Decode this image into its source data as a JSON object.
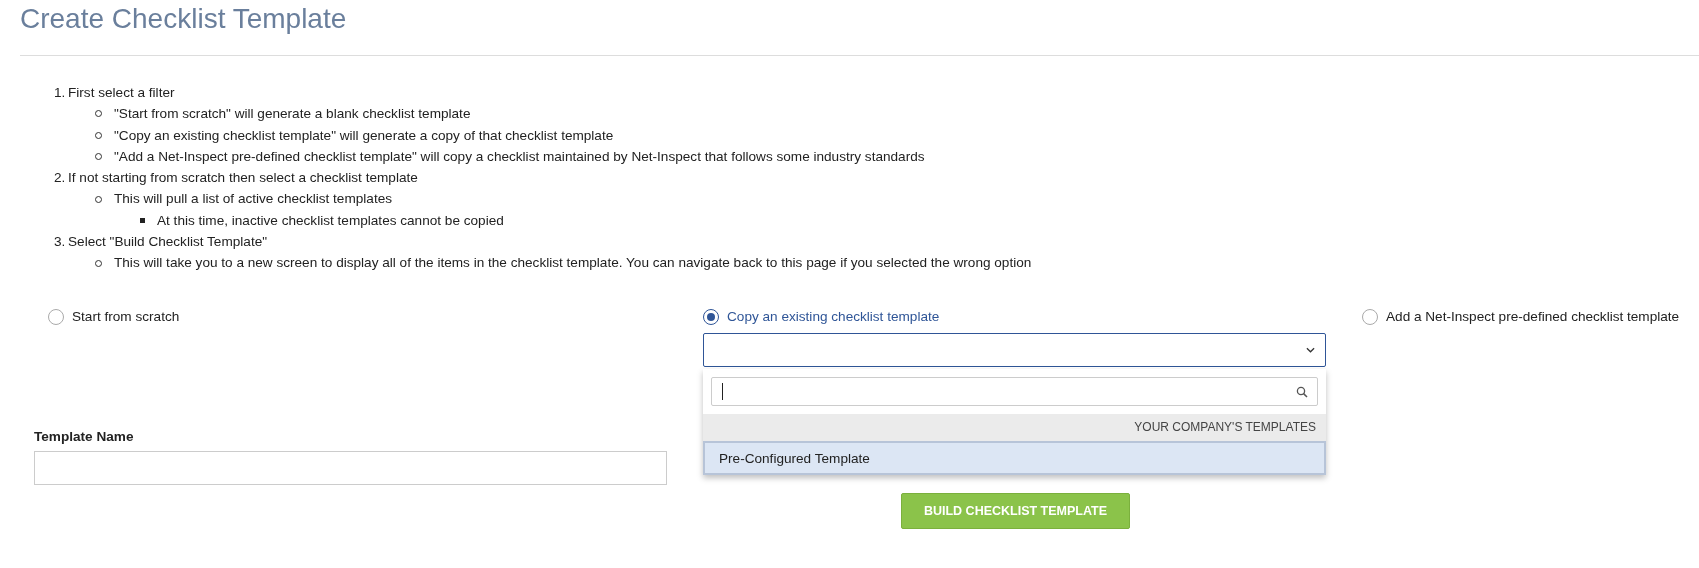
{
  "title": "Create Checklist Template",
  "instructions": [
    {
      "number": "1.",
      "text": "First select a filter",
      "children": [
        {
          "text": "\"Start from scratch\" will generate a blank checklist template"
        },
        {
          "text": "\"Copy an existing checklist template\" will generate a copy of that checklist template"
        },
        {
          "text": "\"Add a Net-Inspect pre-defined checklist template\" will copy a checklist maintained by Net-Inspect that follows some industry standards"
        }
      ]
    },
    {
      "number": "2.",
      "text": "If not starting from scratch then select a checklist template",
      "children": [
        {
          "text": "This will pull a list of active checklist templates",
          "children": [
            {
              "text": "At this time, inactive checklist templates cannot be copied"
            }
          ]
        }
      ]
    },
    {
      "number": "3.",
      "text": "Select \"Build Checklist Template\"",
      "children": [
        {
          "text": "This will take you to a new screen to display all of the items in the checklist template. You can navigate back to this page if you selected the wrong option"
        }
      ]
    }
  ],
  "filter_options": [
    {
      "label": "Start from scratch",
      "selected": false
    },
    {
      "label": "Copy an existing checklist template",
      "selected": true
    },
    {
      "label": "Add a Net-Inspect pre-defined checklist template",
      "selected": false
    }
  ],
  "template_select": {
    "expanded": true,
    "group_header": "YOUR COMPANY'S TEMPLATES",
    "options": [
      {
        "label": "Pre-Configured Template",
        "selected": true
      }
    ]
  },
  "template_name": {
    "label": "Template Name"
  },
  "build_button": {
    "label": "BUILD CHECKLIST TEMPLATE"
  }
}
